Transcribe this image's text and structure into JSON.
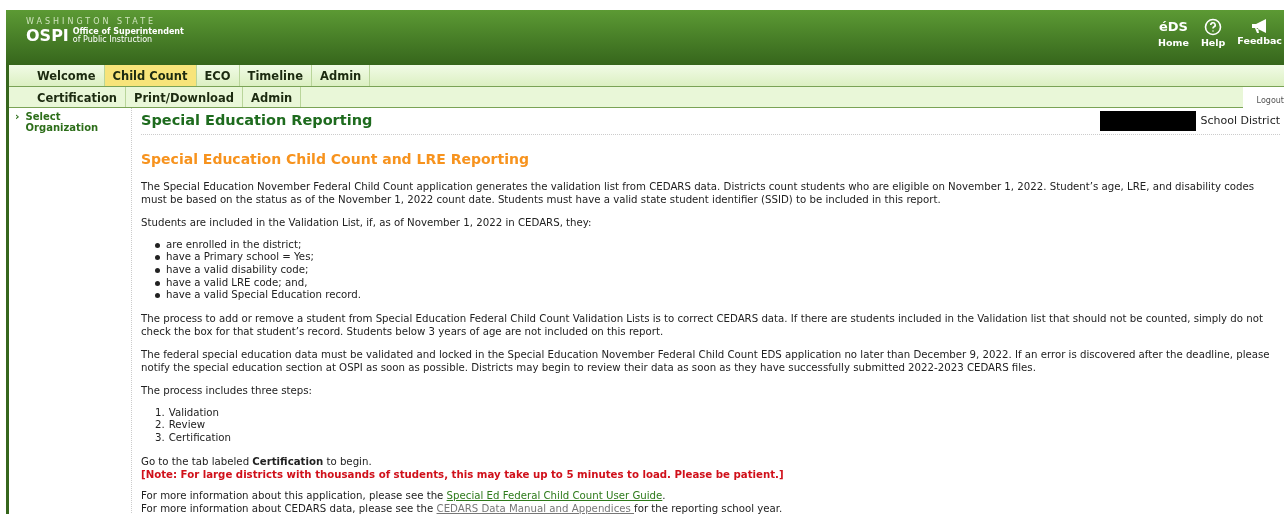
{
  "header": {
    "state_label": "WASHINGTON STATE",
    "logo": "OSPI",
    "org_line_1": "Office of Superintendent",
    "org_line_2": "of Public Instruction",
    "eds_logo": "éDS",
    "nav": [
      {
        "label": "Home",
        "kind": "home"
      },
      {
        "label": "Help",
        "kind": "help"
      },
      {
        "label": "Feedbac",
        "kind": "feedback"
      }
    ]
  },
  "tabs": [
    {
      "label": "Welcome",
      "selected": false
    },
    {
      "label": "Child Count",
      "selected": true
    },
    {
      "label": "ECO",
      "selected": false
    },
    {
      "label": "Timeline",
      "selected": false
    },
    {
      "label": "Admin",
      "selected": false
    }
  ],
  "subtabs": [
    {
      "label": "Certification",
      "selected": false
    },
    {
      "label": "Print/Download",
      "selected": false
    },
    {
      "label": "Admin",
      "selected": false
    }
  ],
  "logout": "Logout",
  "sidebar": {
    "marker": "›",
    "items": [
      {
        "label": "Select Organization"
      }
    ]
  },
  "page_title": "Special Education Reporting",
  "organization": {
    "redacted": true,
    "suffix": "School District"
  },
  "heading": "Special Education Child Count and LRE Reporting",
  "intro": "The Special Education November Federal Child Count application generates the validation list from CEDARS data. Districts count students who are eligible on November 1, 2022. Student’s age, LRE, and disability codes must be based on the status as of the November 1, 2022 count date. Students must have a valid state student identifier (SSID) to be included in this report.",
  "criteria_intro": "Students are included in the Validation List, if, as of November 1, 2022 in CEDARS, they:",
  "criteria": [
    "are enrolled in the district;",
    "have a Primary school = Yes;",
    "have a valid disability code;",
    "have a valid LRE code; and,",
    "have a valid Special Education record."
  ],
  "process_text": "The process to add or remove a student from Special Education Federal Child Count Validation Lists is to correct CEDARS data. If there are students included in the Validation list that should not be counted, simply do not check the box for that student’s record. Students below 3 years of age are not included on this report.",
  "deadline_text": "The federal special education data must be validated and locked in the Special Education November Federal Child Count EDS application no later than December 9, 2022. If an error is discovered after the deadline, please notify the special education section at OSPI as soon as possible. Districts may begin to review their data as soon as they have successfully submitted 2022-2023 CEDARS files.",
  "steps_intro": "The process includes three steps:",
  "steps": [
    {
      "number": "1.",
      "label": "Validation"
    },
    {
      "number": "2.",
      "label": "Review"
    },
    {
      "number": "3.",
      "label": "Certification"
    }
  ],
  "start_text": "Go to the tab labeled **Certification** to begin.",
  "note": "[Note: For large districts with thousands of students, this may take up to 5 minutes to load. Please be patient.]",
  "more_info": [
    {
      "before": "For more information about this application, please see the ",
      "link": "Special Ed Federal Child Count User Guide",
      "after": ".",
      "visited": false
    },
    {
      "before": "For more information about CEDARS data, please see the ",
      "link": "CEDARS Data Manual and Appendices ",
      "after": "for the reporting school year.",
      "visited": true
    }
  ]
}
